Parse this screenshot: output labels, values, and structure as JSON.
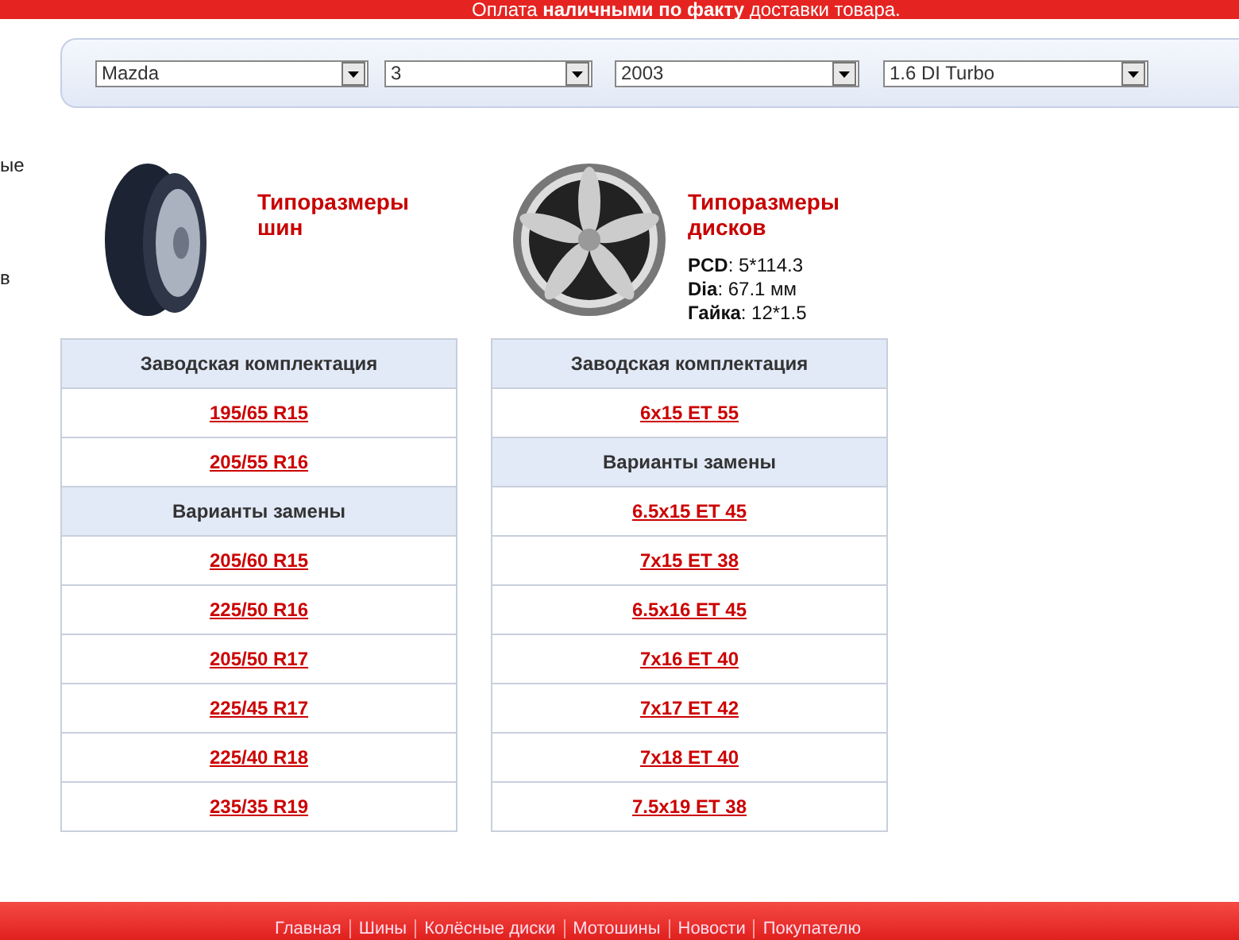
{
  "banner": "Оплата **наличными по факту** доставки товара.",
  "selectors": [
    {
      "value": "Mazda"
    },
    {
      "value": "3"
    },
    {
      "value": "2003"
    },
    {
      "value": "1.6 DI Turbo"
    }
  ],
  "side_fragments": [
    "ые",
    "в"
  ],
  "sections": [
    {
      "kind": "tire",
      "title": "Типоразмеры шин",
      "rows": [
        {
          "kind": "header",
          "text": "Заводская комплектация"
        },
        {
          "kind": "link",
          "text": "195/65 R15"
        },
        {
          "kind": "link",
          "text": "205/55 R16"
        },
        {
          "kind": "header",
          "text": "Варианты замены"
        },
        {
          "kind": "link",
          "text": "205/60 R15"
        },
        {
          "kind": "link",
          "text": "225/50 R16"
        },
        {
          "kind": "link",
          "text": "205/50 R17"
        },
        {
          "kind": "link",
          "text": "225/45 R17"
        },
        {
          "kind": "link",
          "text": "225/40 R18"
        },
        {
          "kind": "link",
          "text": "235/35 R19"
        }
      ]
    },
    {
      "kind": "wheel",
      "title": "Типоразмеры дисков",
      "specs": [
        "**PCD**: 5*114.3",
        "**Dia**: 67.1 мм",
        "**Гайка**: 12*1.5"
      ],
      "rows": [
        {
          "kind": "header",
          "text": "Заводская комплектация"
        },
        {
          "kind": "link",
          "text": "6x15 ET 55"
        },
        {
          "kind": "header",
          "text": "Варианты замены"
        },
        {
          "kind": "link",
          "text": "6.5x15 ET 45"
        },
        {
          "kind": "link",
          "text": "7x15 ET 38"
        },
        {
          "kind": "link",
          "text": "6.5x16 ET 45"
        },
        {
          "kind": "link",
          "text": "7x16 ET 40"
        },
        {
          "kind": "link",
          "text": "7x17 ET 42"
        },
        {
          "kind": "link",
          "text": "7x18 ET 40"
        },
        {
          "kind": "link",
          "text": "7.5x19 ET 38"
        }
      ]
    }
  ],
  "footer_links": [
    "Главная",
    "Шины",
    "Колёсные диски",
    "Мотошины",
    "Новости",
    "Покупателю"
  ]
}
